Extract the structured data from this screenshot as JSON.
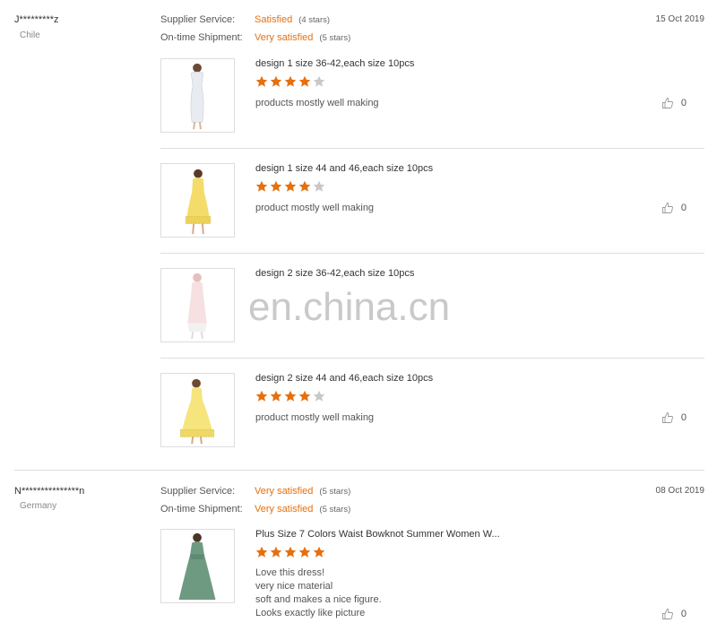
{
  "reviews": [
    {
      "buyer": "J*********z",
      "country": "Chile",
      "date": "15 Oct 2019",
      "supplier_label": "Supplier Service:",
      "supplier_value": "Satisfied",
      "supplier_stars": "(4 stars)",
      "shipment_label": "On-time Shipment:",
      "shipment_value": "Very satisfied",
      "shipment_stars": "(5 stars)",
      "items": [
        {
          "title": "design 1 size 36-42,each size 10pcs",
          "rating": 4,
          "comment": "products mostly well making",
          "likes": "0"
        },
        {
          "title": "design 1 size 44 and 46,each size 10pcs",
          "rating": 4,
          "comment": "product mostly well making",
          "likes": "0"
        },
        {
          "title": "design 2 size 36-42,each size 10pcs"
        },
        {
          "title": "design 2 size 44 and 46,each size 10pcs",
          "rating": 4,
          "comment": "product mostly well making",
          "likes": "0"
        }
      ]
    },
    {
      "buyer": "N***************n",
      "country": "Germany",
      "date": "08 Oct 2019",
      "supplier_label": "Supplier Service:",
      "supplier_value": "Very satisfied",
      "supplier_stars": "(5 stars)",
      "shipment_label": "On-time Shipment:",
      "shipment_value": "Very satisfied",
      "shipment_stars": "(5 stars)",
      "items": [
        {
          "title": "Plus Size 7 Colors Waist Bowknot Summer Women W...",
          "rating": 5,
          "comment": "Love this dress!\nvery nice material\nsoft and makes a nice figure.\nLooks exactly like picture",
          "likes": "0"
        }
      ]
    }
  ],
  "watermark": "en.china.cn",
  "colors": {
    "accent": "#e5700f",
    "star_on": "#e5700f",
    "star_off": "#c8c8c8"
  }
}
